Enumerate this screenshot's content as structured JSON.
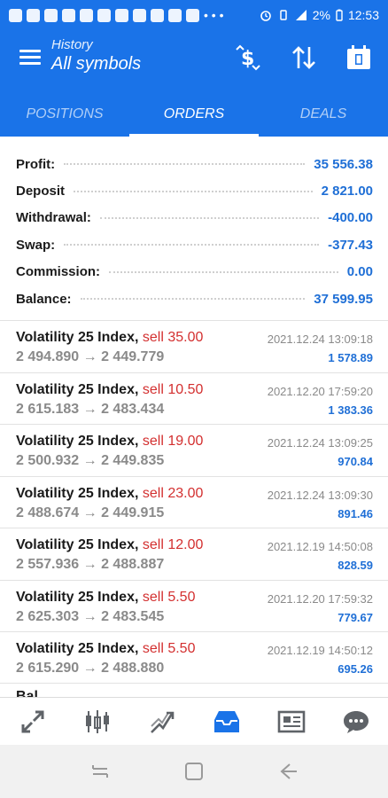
{
  "status_bar": {
    "battery": "2%",
    "time": "12:53"
  },
  "header": {
    "subtitle": "History",
    "title": "All symbols"
  },
  "tabs": [
    {
      "label": "POSITIONS",
      "active": false
    },
    {
      "label": "ORDERS",
      "active": true
    },
    {
      "label": "DEALS",
      "active": false
    }
  ],
  "summary": [
    {
      "label": "Profit:",
      "value": "35 556.38"
    },
    {
      "label": "Deposit",
      "value": "2 821.00"
    },
    {
      "label": "Withdrawal:",
      "value": "-400.00"
    },
    {
      "label": "Swap:",
      "value": "-377.43"
    },
    {
      "label": "Commission:",
      "value": "0.00"
    },
    {
      "label": "Balance:",
      "value": "37 599.95"
    }
  ],
  "deals": [
    {
      "symbol": "Volatility 25 Index,",
      "action": "sell 35.00",
      "prices": "2 494.890 → 2 449.779",
      "time": "2021.12.24 13:09:18",
      "profit": "1 578.89"
    },
    {
      "symbol": "Volatility 25 Index,",
      "action": "sell 10.50",
      "prices": "2 615.183 → 2 483.434",
      "time": "2021.12.20 17:59:20",
      "profit": "1 383.36"
    },
    {
      "symbol": "Volatility 25 Index,",
      "action": "sell 19.00",
      "prices": "2 500.932 → 2 449.835",
      "time": "2021.12.24 13:09:25",
      "profit": "970.84"
    },
    {
      "symbol": "Volatility 25 Index,",
      "action": "sell 23.00",
      "prices": "2 488.674 → 2 449.915",
      "time": "2021.12.24 13:09:30",
      "profit": "891.46"
    },
    {
      "symbol": "Volatility 25 Index,",
      "action": "sell 12.00",
      "prices": "2 557.936 → 2 488.887",
      "time": "2021.12.19 14:50:08",
      "profit": "828.59"
    },
    {
      "symbol": "Volatility 25 Index,",
      "action": "sell 5.50",
      "prices": "2 625.303 → 2 483.545",
      "time": "2021.12.20 17:59:32",
      "profit": "779.67"
    },
    {
      "symbol": "Volatility 25 Index,",
      "action": "sell 5.50",
      "prices": "2 615.290 → 2 488.880",
      "time": "2021.12.19 14:50:12",
      "profit": "695.26"
    }
  ],
  "balance_peek": "Bal",
  "colors": {
    "primary": "#1a73e8",
    "profit_blue": "#1f6fd6",
    "sell_red": "#d32f2f"
  },
  "bottom_nav": [
    {
      "icon": "quotes-icon"
    },
    {
      "icon": "chart-icon"
    },
    {
      "icon": "trade-icon"
    },
    {
      "icon": "history-icon",
      "active": true
    },
    {
      "icon": "news-icon"
    },
    {
      "icon": "chat-icon"
    }
  ]
}
